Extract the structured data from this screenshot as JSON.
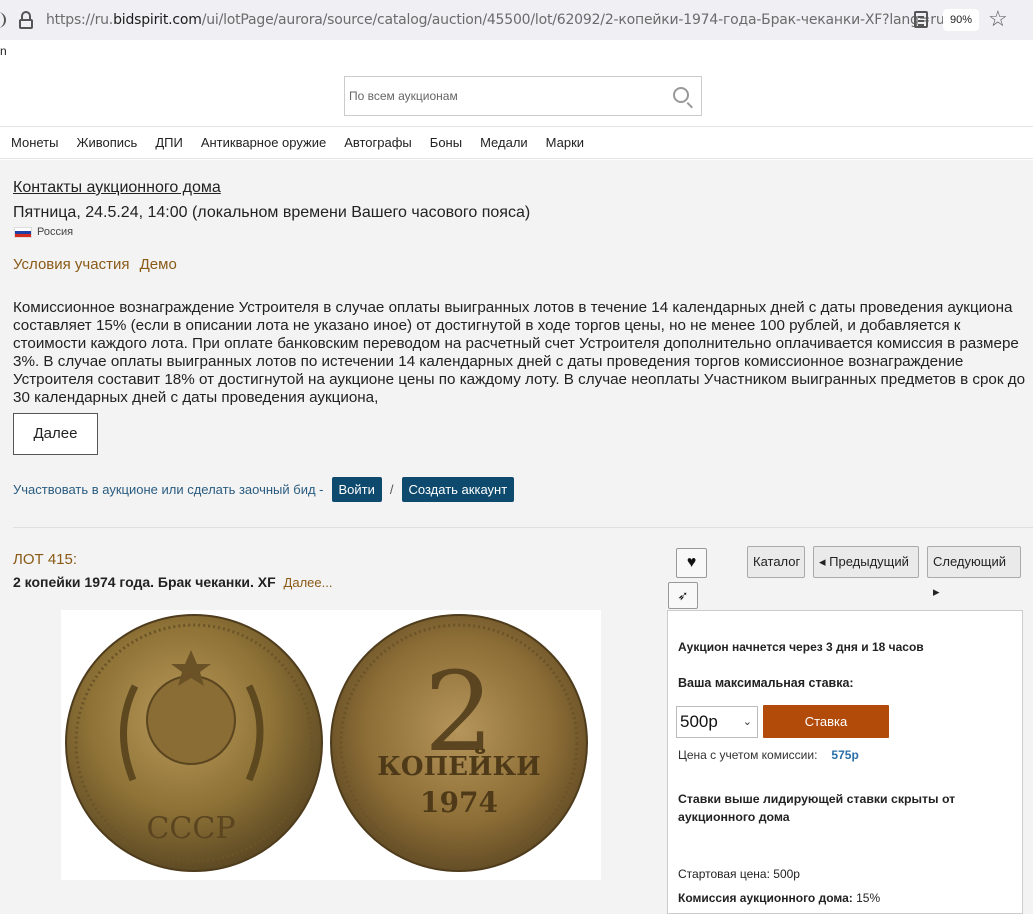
{
  "browser": {
    "url_prefix": "https://ru.",
    "url_domain": "bidspirit.com",
    "url_rest": "/ui/lotPage/aurora/source/catalog/auction/45500/lot/62092/2-копейки-1974-года-Брак-чеканки-XF?lang=ru",
    "zoom": "90%"
  },
  "stub_text": "n",
  "search": {
    "placeholder": "По всем аукционам"
  },
  "nav": [
    "Монеты",
    "Живопись",
    "ДПИ",
    "Антикварное оружие",
    "Автографы",
    "Боны",
    "Медали",
    "Марки"
  ],
  "auction": {
    "contacts_link": "Контакты аукционного дома",
    "date_line": "Пятница, 24.5.24, 14:00 (локальном времени Вашего часового пояса)",
    "country": "Россия",
    "conditions": "Условия участия",
    "demo": "Демо",
    "commission_text": "Комиссионное вознаграждение Устроителя в случае оплаты выигранных лотов в течение 14 календарных дней с даты проведения аукциона составляет 15% (если в описании лота не указано иное) от достигнутой в ходе торгов цены, но не менее 100 рублей, и добавляется к стоимости каждого лота. При оплате банковским переводом на расчетный счет Устроителя дополнительно оплачивается комиссия в размере 3%. В случае оплаты выигранных лотов по истечении 14 календарных дней с даты проведения торгов комиссионное вознаграждение Устроителя составит 18% от достигнутой на аукционе цены по каждому лоту. В случае неоплаты Участником выигранных предметов в срок до 30 календарных дней с даты проведения аукциона,",
    "more_button": "Далее",
    "participate_text": "Участвовать в аукционе или сделать заочный бид -",
    "login_button": "Войти",
    "separator": "/",
    "create_account_button": "Создать аккаунт"
  },
  "lot": {
    "number": "ЛОТ 415:",
    "title": "2 копейки 1974 года. Брак чеканки. XF",
    "more_link": "Далее...",
    "coin_face_text": "2",
    "coin_denomination": "КОПЕЙКИ",
    "coin_year": "1974",
    "coin_country": "СССР"
  },
  "lot_nav": {
    "catalog": "Каталог",
    "prev": "Предыдущий",
    "next": "Следующий"
  },
  "bid_panel": {
    "starts_in": "Аукцион начнется через 3 дня и 18 часов",
    "max_bid_label": "Ваша максимальная ставка:",
    "bid_value": "500р",
    "bid_button": "Ставка",
    "price_label": "Цена с учетом комиссии:",
    "price_value": "575р",
    "hidden_note": "Ставки выше лидирующей ставки скрыты от аукционного дома",
    "start_price": "Стартовая цена: 500р",
    "commission_label": "Комиссия аукционного дома:",
    "commission_value": "15%"
  },
  "colors": {
    "accent_brown": "#8a5a16",
    "button_dark": "#0d4a6e",
    "bid_orange": "#b24b09",
    "link_blue": "#2a6fa8"
  }
}
